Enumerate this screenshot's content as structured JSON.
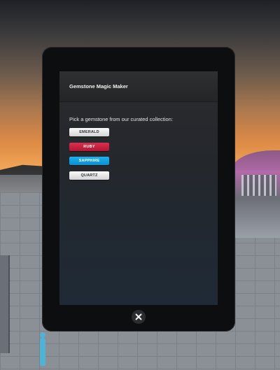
{
  "app": {
    "title": "Gemstone Magic Maker"
  },
  "main": {
    "prompt": "Pick a gemstone from our curated collection:",
    "gemstones": [
      {
        "label": "EMERALD"
      },
      {
        "label": "RUBY"
      },
      {
        "label": "SAPPHIRE"
      },
      {
        "label": "QUARTZ"
      }
    ]
  },
  "controls": {
    "close_icon": "close-icon"
  },
  "colors": {
    "ruby": "#c8203f",
    "sapphire": "#129fdf",
    "emerald_button": "#e8e8e8",
    "quartz_button": "#e8e8e8",
    "screen_background": "#24272c"
  }
}
